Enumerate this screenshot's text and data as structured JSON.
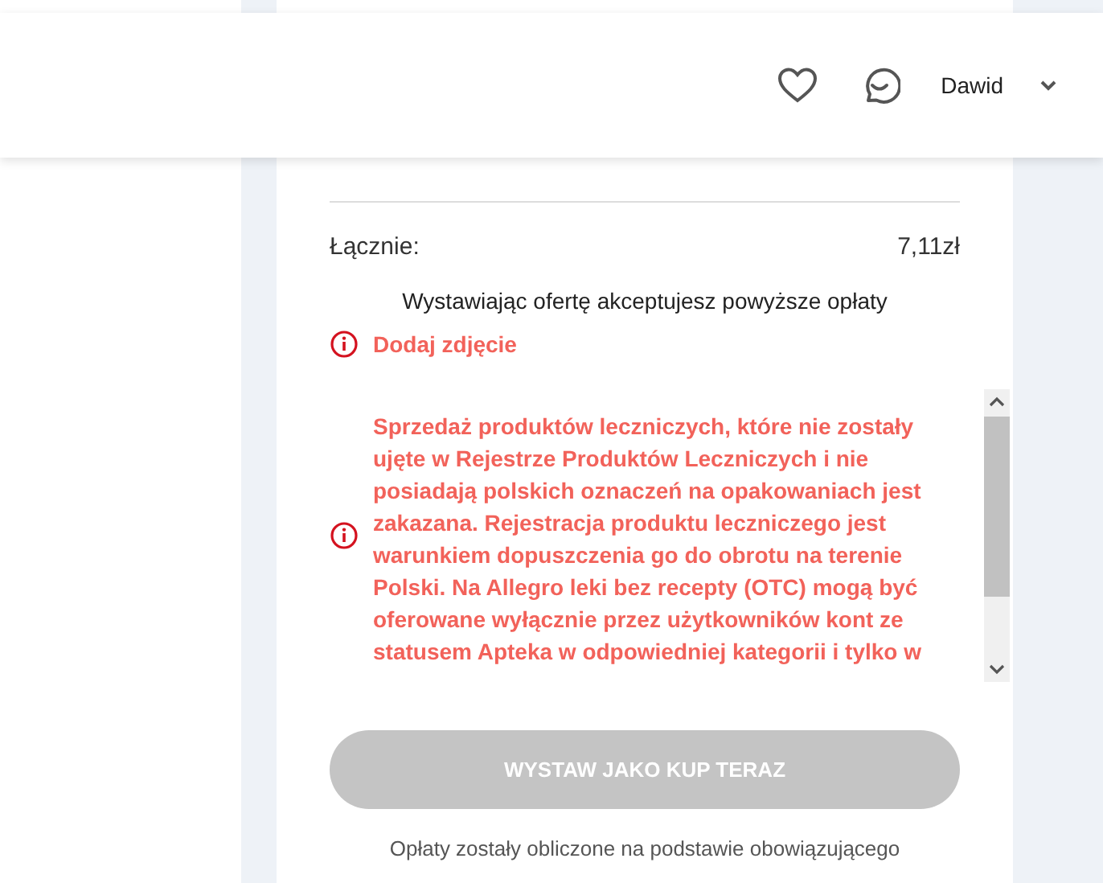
{
  "header": {
    "user_name": "Dawid"
  },
  "total": {
    "label": "Łącznie:",
    "value": "7,11zł"
  },
  "acceptance_note": "Wystawiając ofertę akceptujesz powyższe opłaty",
  "errors": [
    {
      "kind": "inline",
      "text": "Dodaj zdjęcie"
    },
    {
      "kind": "scrollbox",
      "text": "Sprzedaż produktów leczniczych, które nie zostały ujęte w Rejestrze Produktów Leczniczych i nie posiadają polskich oznaczeń na opakowaniach jest zakazana. Rejestracja produktu leczniczego jest warunkiem dopuszczenia go do obrotu na terenie Polski. Na Allegro leki bez recepty (OTC) mogą być oferowane wyłącznie przez użytkowników kont ze statusem Apteka w odpowiedniej kategorii i tylko w"
    }
  ],
  "submit_button": {
    "label": "WYSTAW JAKO KUP TERAZ",
    "disabled": true
  },
  "footer_note": "Opłaty zostały obliczone na podstawie obowiązującego"
}
